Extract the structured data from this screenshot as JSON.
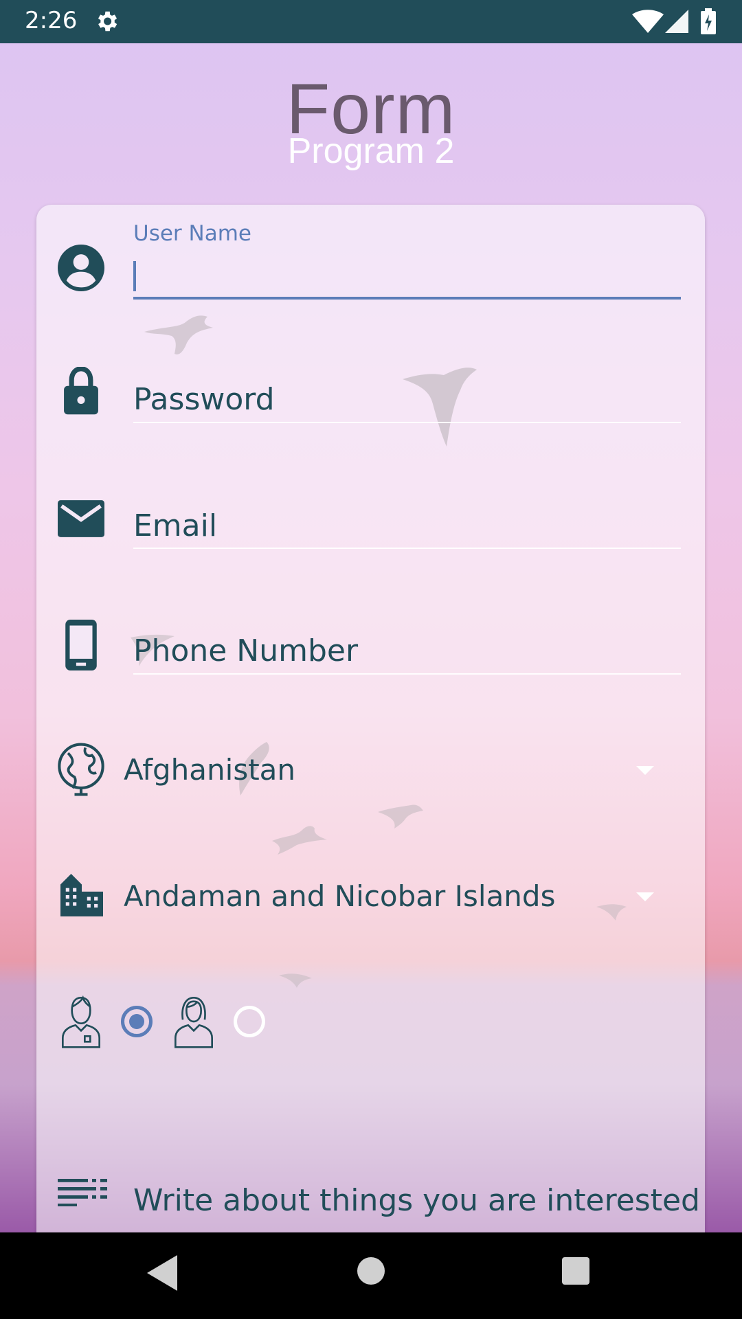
{
  "status_bar": {
    "time": "2:26",
    "icons": [
      "gear-icon",
      "wifi-icon",
      "signal-icon",
      "battery-charging-icon"
    ]
  },
  "header": {
    "title": "Form",
    "subtitle": "Program 2"
  },
  "form": {
    "username": {
      "label": "User Name",
      "value": "",
      "icon": "account-circle-icon"
    },
    "password": {
      "placeholder": "Password",
      "icon": "lock-icon"
    },
    "email": {
      "placeholder": "Email",
      "icon": "mail-icon"
    },
    "phone": {
      "placeholder": "Phone Number",
      "icon": "smartphone-icon"
    },
    "country": {
      "selected": "Afghanistan",
      "icon": "globe-icon"
    },
    "state": {
      "selected": "Andaman and Nicobar Islands",
      "icon": "city-icon"
    },
    "gender": {
      "options": [
        {
          "icon": "male-avatar-icon",
          "selected": true
        },
        {
          "icon": "female-avatar-icon",
          "selected": false
        }
      ]
    },
    "interests": {
      "placeholder": "Write about things you are interested",
      "icon": "notes-icon"
    }
  },
  "colors": {
    "status_bar": "#214d59",
    "accent": "#5b7db8",
    "text": "#214d59"
  },
  "nav_bar": {
    "buttons": [
      "back-icon",
      "home-icon",
      "recents-icon"
    ]
  }
}
